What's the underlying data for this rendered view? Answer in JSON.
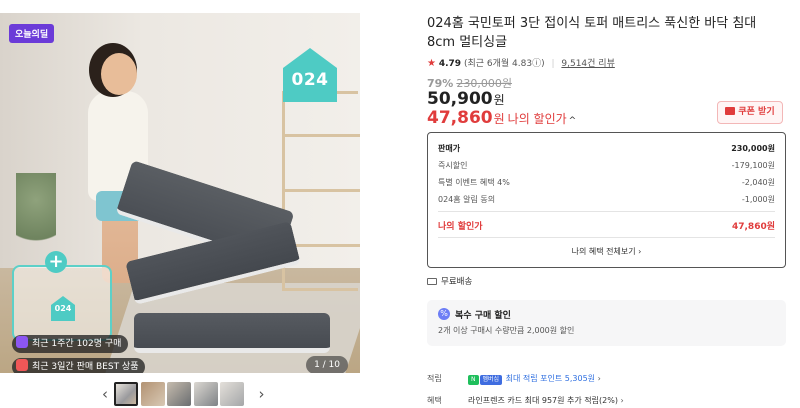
{
  "gallery": {
    "badge": "오늘의딜",
    "brand_logo": "024",
    "bag_logo": "024",
    "pill_recent_purchase": "최근 1주간 102명 구매",
    "pill_best": "최근 3일간 판매 BEST 상품",
    "page_counter": "1 / 10",
    "prev_icon": "‹",
    "next_icon": "›",
    "thumbnail_count": 5,
    "bag_plus": "+"
  },
  "product": {
    "title": "024홈 국민토퍼 3단 접이식 토퍼 매트리스 푹신한 바닥 침대 8cm 멀티싱글",
    "rating": {
      "star": "★",
      "score": "4.79",
      "recent": "(최근 6개월 4.83",
      "recent_close": ")",
      "info_icon": "ⓘ",
      "reviews": "9,514건 리뷰"
    },
    "discount_rate": "79%",
    "original_price": "230,000원",
    "price": "50,900",
    "price_unit": "원",
    "my_price": "47,860",
    "my_price_unit": "원",
    "my_price_label": "나의 할인가",
    "my_price_chevron": "^",
    "coupon_button": "쿠폰 받기"
  },
  "breakdown": {
    "rows": [
      {
        "label": "판매가",
        "value": "230,000원"
      },
      {
        "label": "즉시할인",
        "value": "-179,100원"
      },
      {
        "label": "특별 이벤트 혜택 4%",
        "value": "-2,040원"
      },
      {
        "label": "024홈 알림 동의",
        "value": "-1,000원"
      }
    ],
    "my_price_label": "나의 할인가",
    "my_price_value": "47,860원",
    "more_link": "나의 혜택 전체보기 ›"
  },
  "shipping": {
    "label": "무료배송"
  },
  "multi_buy": {
    "icon": "%",
    "title": "복수 구매 할인",
    "desc": "2개 이상 구매시 수량만큼 2,000원 할인"
  },
  "perks": {
    "points_label": "적립",
    "points_badge_1": "N",
    "points_badge_2": "멤버십",
    "points_text": "최대 적립 포인트 5,305원",
    "points_chevron": "›",
    "benefit_label": "혜택",
    "benefit_text": "라인프렌즈 카드 최대 957원 추가 적립(2%)",
    "benefit_chevron": "›"
  },
  "colors": {
    "accent_red": "#e03c3c",
    "brand_mint": "#5cd0c8",
    "badge_purple": "#6b3bd8",
    "points_blue": "#2f6fe0"
  }
}
